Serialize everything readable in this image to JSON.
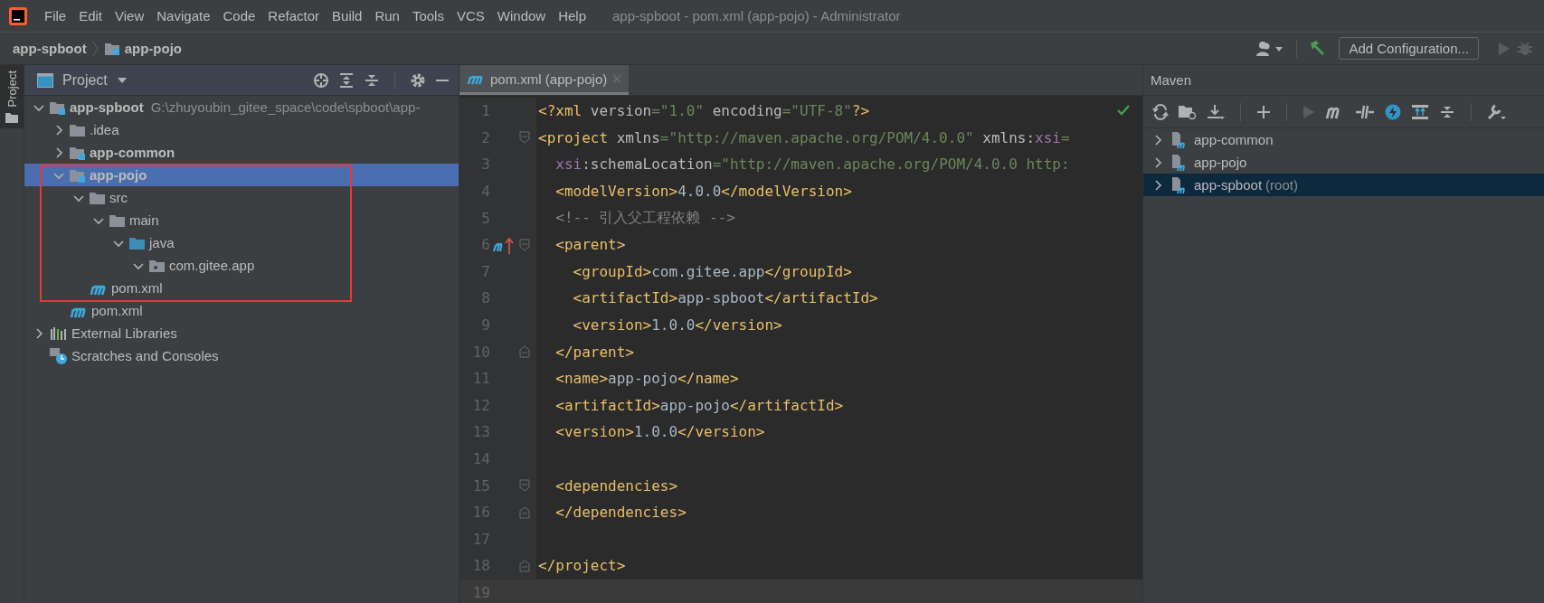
{
  "window": {
    "title": "app-spboot - pom.xml (app-pojo) - Administrator"
  },
  "menu": [
    "File",
    "Edit",
    "View",
    "Navigate",
    "Code",
    "Refactor",
    "Build",
    "Run",
    "Tools",
    "VCS",
    "Window",
    "Help"
  ],
  "breadcrumb": [
    {
      "label": "app-spboot",
      "kind": "project"
    },
    {
      "label": "app-pojo",
      "kind": "module"
    }
  ],
  "toolbar": {
    "run_config_button": "Add Configuration..."
  },
  "side_tab": {
    "label": "Project",
    "selected": true
  },
  "project": {
    "title": "Project",
    "tree": [
      {
        "name": "app-spboot",
        "kind": "module",
        "path": "G:\\zhuyoubin_gitee_space\\code\\spboot\\app-",
        "expanded": true,
        "selected": false,
        "children": [
          {
            "name": ".idea",
            "kind": "folder",
            "expanded": false,
            "selected": false
          },
          {
            "name": "app-common",
            "kind": "module",
            "expanded": false,
            "selected": false
          },
          {
            "name": "app-pojo",
            "kind": "module",
            "expanded": true,
            "selected": true,
            "outlined": true,
            "children": [
              {
                "name": "src",
                "kind": "folder",
                "expanded": true,
                "selected": false,
                "children": [
                  {
                    "name": "main",
                    "kind": "folder",
                    "expanded": true,
                    "selected": false,
                    "children": [
                      {
                        "name": "java",
                        "kind": "source",
                        "expanded": true,
                        "selected": false,
                        "children": [
                          {
                            "name": "com.gitee.app",
                            "kind": "package",
                            "expanded": true,
                            "selected": false
                          }
                        ]
                      }
                    ]
                  }
                ]
              },
              {
                "name": "pom.xml",
                "kind": "pom",
                "selected": false
              }
            ]
          },
          {
            "name": "pom.xml",
            "kind": "pom",
            "selected": false
          }
        ]
      },
      {
        "name": "External Libraries",
        "kind": "libraries",
        "expanded": false,
        "selected": false
      },
      {
        "name": "Scratches and Consoles",
        "kind": "scratches",
        "selected": false
      }
    ]
  },
  "editor": {
    "tabs": [
      {
        "label": "pom.xml (app-pojo)",
        "selected": true
      }
    ],
    "lines": [
      {
        "number": "1",
        "current": false,
        "fold_start": false,
        "fold_end": false,
        "marker": false,
        "tokens": [
          {
            "t": "<?xml",
            "kind": "tag"
          },
          {
            "t": " version",
            "kind": "attr"
          },
          {
            "t": "=\"1.0\"",
            "kind": "str"
          },
          {
            "t": " encoding",
            "kind": "attr"
          },
          {
            "t": "=\"UTF-8\"",
            "kind": "str"
          },
          {
            "t": "?>",
            "kind": "tag"
          }
        ]
      },
      {
        "number": "2",
        "current": false,
        "fold_start": true,
        "fold_end": false,
        "marker": false,
        "tokens": [
          {
            "t": "<project",
            "kind": "tag"
          },
          {
            "t": " xmlns",
            "kind": "attr"
          },
          {
            "t": "=\"http://maven.apache.org/POM/4.0.0\"",
            "kind": "str"
          },
          {
            "t": " xmlns:",
            "kind": "attr"
          },
          {
            "t": "xsi",
            "kind": "ns"
          },
          {
            "t": "=",
            "kind": "str"
          }
        ]
      },
      {
        "number": "3",
        "current": false,
        "fold_start": false,
        "fold_end": false,
        "marker": false,
        "tokens": [
          {
            "t": "  xsi",
            "kind": "ns"
          },
          {
            "t": ":schemaLocation",
            "kind": "attr"
          },
          {
            "t": "=\"http://maven.apache.org/POM/4.0.0 http:",
            "kind": "str"
          }
        ]
      },
      {
        "number": "4",
        "current": false,
        "fold_start": false,
        "fold_end": false,
        "marker": false,
        "tokens": [
          {
            "t": "  <modelVersion>",
            "kind": "tag"
          },
          {
            "t": "4.0.0",
            "kind": "text"
          },
          {
            "t": "</modelVersion>",
            "kind": "tag"
          }
        ]
      },
      {
        "number": "5",
        "current": false,
        "fold_start": false,
        "fold_end": false,
        "marker": false,
        "tokens": [
          {
            "t": "  <!-- 引入父工程依赖 -->",
            "kind": "comment"
          }
        ]
      },
      {
        "number": "6",
        "current": false,
        "fold_start": true,
        "fold_end": false,
        "marker": true,
        "tokens": [
          {
            "t": "  <parent>",
            "kind": "tag"
          }
        ]
      },
      {
        "number": "7",
        "current": false,
        "fold_start": false,
        "fold_end": false,
        "marker": false,
        "tokens": [
          {
            "t": "    <groupId>",
            "kind": "tag"
          },
          {
            "t": "com.gitee.app",
            "kind": "text"
          },
          {
            "t": "</groupId>",
            "kind": "tag"
          }
        ]
      },
      {
        "number": "8",
        "current": false,
        "fold_start": false,
        "fold_end": false,
        "marker": false,
        "tokens": [
          {
            "t": "    <artifactId>",
            "kind": "tag"
          },
          {
            "t": "app-spboot",
            "kind": "text"
          },
          {
            "t": "</artifactId>",
            "kind": "tag"
          }
        ]
      },
      {
        "number": "9",
        "current": false,
        "fold_start": false,
        "fold_end": false,
        "marker": false,
        "tokens": [
          {
            "t": "    <version>",
            "kind": "tag"
          },
          {
            "t": "1.0.0",
            "kind": "text"
          },
          {
            "t": "</version>",
            "kind": "tag"
          }
        ]
      },
      {
        "number": "10",
        "current": false,
        "fold_start": false,
        "fold_end": true,
        "marker": false,
        "tokens": [
          {
            "t": "  </parent>",
            "kind": "tag"
          }
        ]
      },
      {
        "number": "11",
        "current": false,
        "fold_start": false,
        "fold_end": false,
        "marker": false,
        "tokens": [
          {
            "t": "  <name>",
            "kind": "tag"
          },
          {
            "t": "app-pojo",
            "kind": "text"
          },
          {
            "t": "</name>",
            "kind": "tag"
          }
        ]
      },
      {
        "number": "12",
        "current": false,
        "fold_start": false,
        "fold_end": false,
        "marker": false,
        "tokens": [
          {
            "t": "  <artifactId>",
            "kind": "tag"
          },
          {
            "t": "app-pojo",
            "kind": "text"
          },
          {
            "t": "</artifactId>",
            "kind": "tag"
          }
        ]
      },
      {
        "number": "13",
        "current": false,
        "fold_start": false,
        "fold_end": false,
        "marker": false,
        "tokens": [
          {
            "t": "  <version>",
            "kind": "tag"
          },
          {
            "t": "1.0.0",
            "kind": "text"
          },
          {
            "t": "</version>",
            "kind": "tag"
          }
        ]
      },
      {
        "number": "14",
        "current": false,
        "fold_start": false,
        "fold_end": false,
        "marker": false
      },
      {
        "number": "15",
        "current": false,
        "fold_start": true,
        "fold_end": false,
        "marker": false,
        "tokens": [
          {
            "t": "  <dependencies>",
            "kind": "tag"
          }
        ]
      },
      {
        "number": "16",
        "current": false,
        "fold_start": false,
        "fold_end": true,
        "marker": false,
        "tokens": [
          {
            "t": "  </dependencies>",
            "kind": "tag"
          }
        ]
      },
      {
        "number": "17",
        "current": false,
        "fold_start": false,
        "fold_end": false,
        "marker": false
      },
      {
        "number": "18",
        "current": false,
        "fold_start": false,
        "fold_end": true,
        "marker": false,
        "tokens": [
          {
            "t": "</project>",
            "kind": "tag"
          }
        ]
      },
      {
        "number": "19",
        "current": true,
        "fold_start": false,
        "fold_end": false,
        "marker": false
      }
    ]
  },
  "maven": {
    "title": "Maven",
    "items": [
      {
        "name": "app-common",
        "selected": false
      },
      {
        "name": "app-pojo",
        "selected": false
      },
      {
        "name": "app-spboot",
        "suffix": "(root)",
        "selected": true
      }
    ]
  }
}
